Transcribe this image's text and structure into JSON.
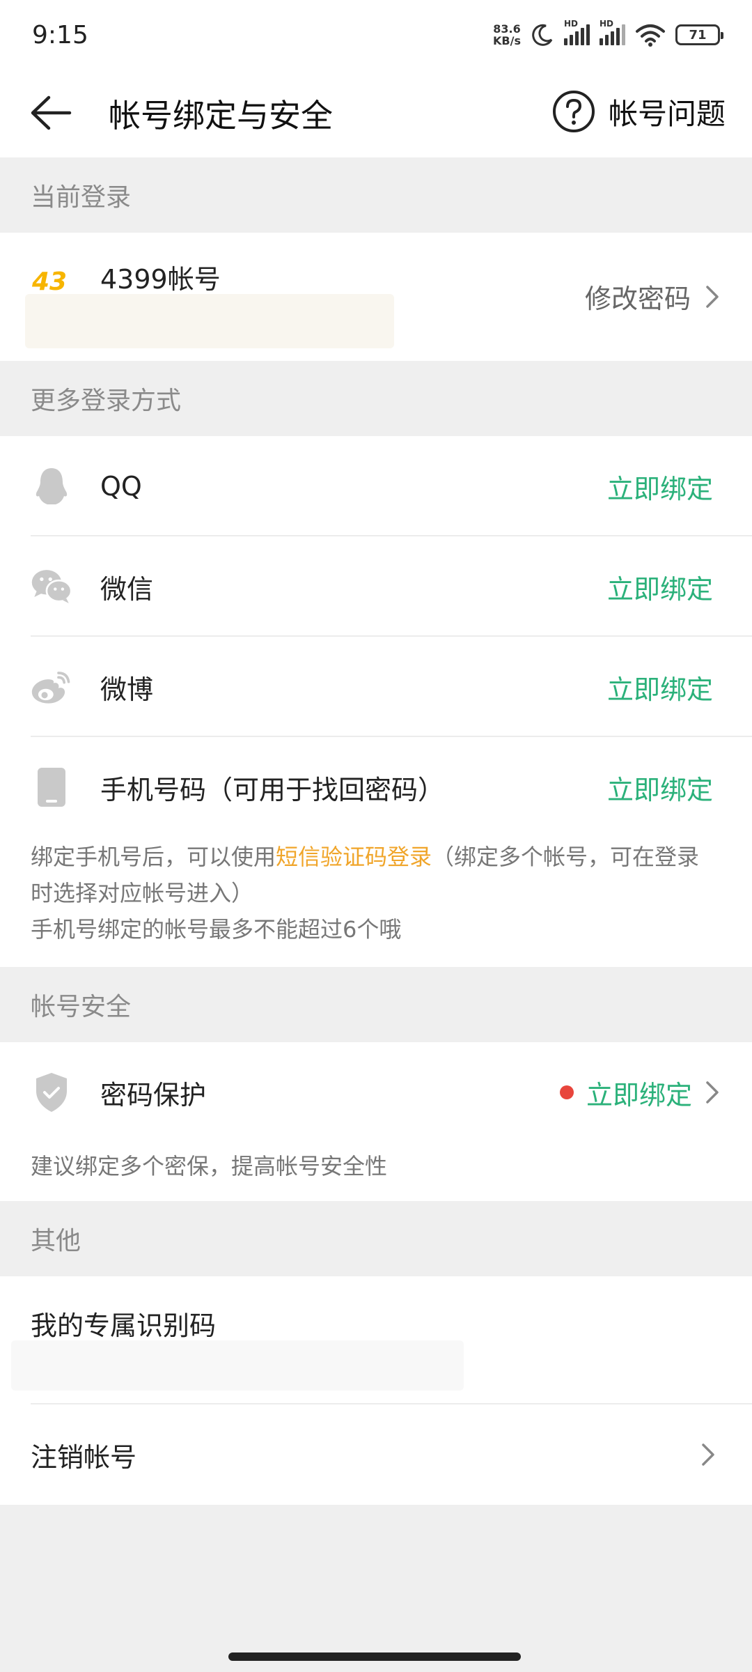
{
  "status": {
    "time": "9:15",
    "net_speed": "83.6",
    "net_unit": "KB/s",
    "hd1": "HD",
    "hd2": "HD",
    "battery": "71"
  },
  "header": {
    "title": "帐号绑定与安全",
    "help_label": "帐号问题"
  },
  "sections": {
    "current_login": "当前登录",
    "more_login": "更多登录方式",
    "security": "帐号安全",
    "other": "其他"
  },
  "current_account": {
    "logo_text": "43",
    "name": "4399帐号",
    "action": "修改密码"
  },
  "login_methods": [
    {
      "label": "QQ",
      "action": "立即绑定"
    },
    {
      "label": "微信",
      "action": "立即绑定"
    },
    {
      "label": "微博",
      "action": "立即绑定"
    },
    {
      "label": "手机号码（可用于找回密码）",
      "action": "立即绑定"
    }
  ],
  "phone_note": {
    "part1": "绑定手机号后，可以使用",
    "highlight": "短信验证码登录",
    "part2": "（绑定多个帐号，可在登录时选择对应帐号进入）",
    "line2": "手机号绑定的帐号最多不能超过6个哦"
  },
  "security": {
    "label": "密码保护",
    "action": "立即绑定",
    "note": "建议绑定多个密保，提高帐号安全性"
  },
  "other": {
    "id_code_label": "我的专属识别码",
    "cancel_label": "注销帐号"
  },
  "colors": {
    "accent_green": "#2bb17a",
    "highlight_orange": "#f0a52a",
    "alert_red": "#e8453c"
  }
}
